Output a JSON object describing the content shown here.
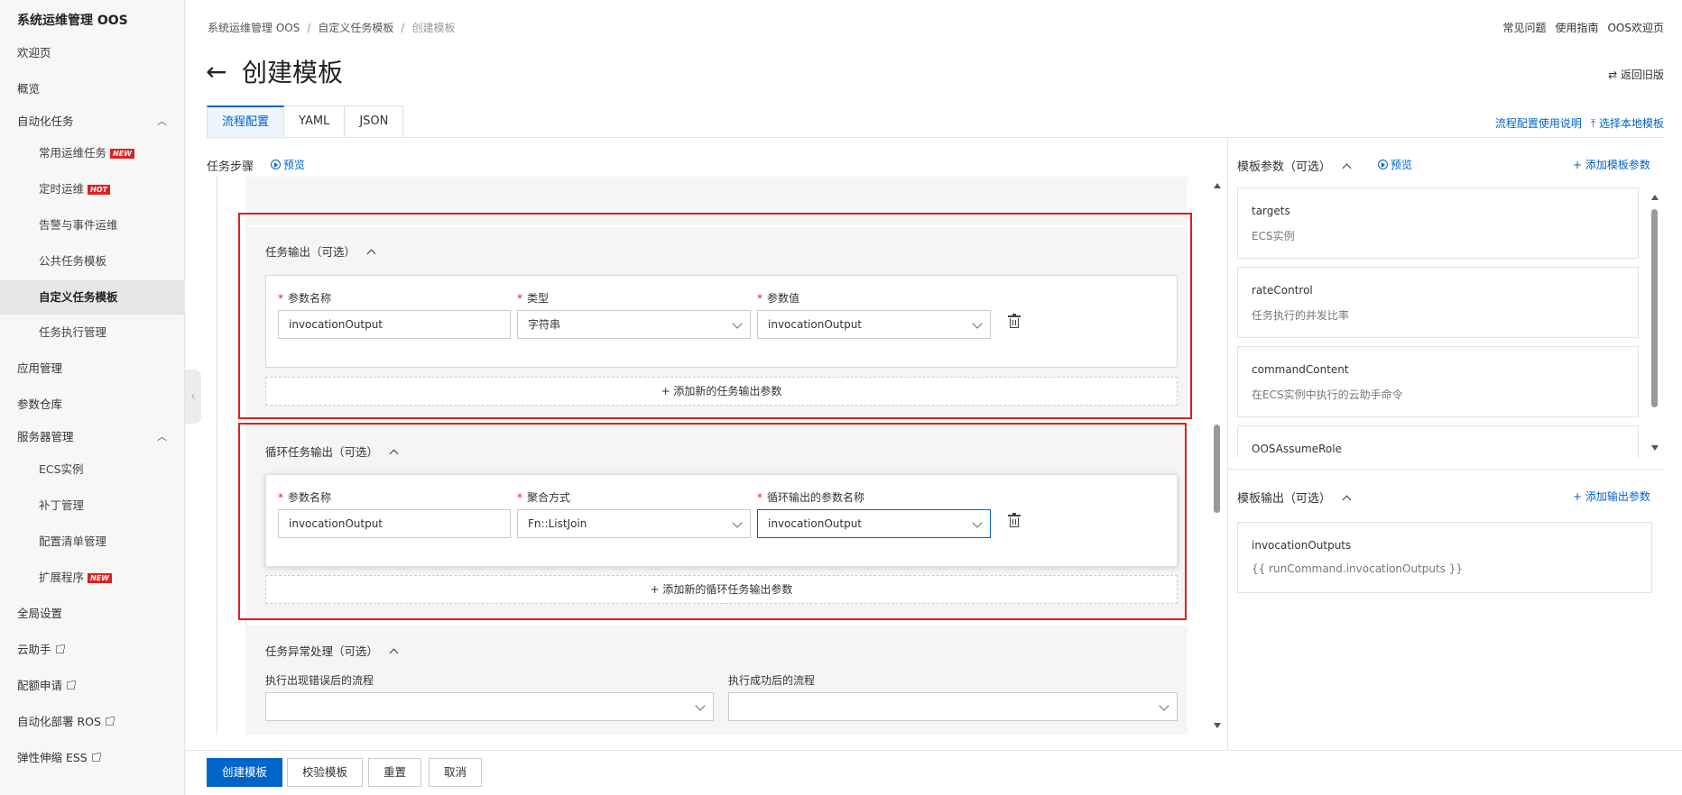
{
  "app": {
    "title": "系统运维管理 OOS"
  },
  "sidebar": {
    "items": [
      {
        "label": "欢迎页"
      },
      {
        "label": "概览"
      },
      {
        "label": "自动化任务"
      },
      {
        "label": "常用运维任务",
        "tag": "NEW"
      },
      {
        "label": "定时运维",
        "tag": "HOT"
      },
      {
        "label": "告警与事件运维"
      },
      {
        "label": "公共任务模板"
      },
      {
        "label": "自定义任务模板"
      },
      {
        "label": "任务执行管理"
      },
      {
        "label": "应用管理"
      },
      {
        "label": "参数仓库"
      },
      {
        "label": "服务器管理"
      },
      {
        "label": "ECS实例"
      },
      {
        "label": "补丁管理"
      },
      {
        "label": "配置清单管理"
      },
      {
        "label": "扩展程序",
        "tag": "NEW"
      },
      {
        "label": "全局设置"
      },
      {
        "label": "云助手"
      },
      {
        "label": "配额申请"
      },
      {
        "label": "自动化部署 ROS"
      },
      {
        "label": "弹性伸缩 ESS"
      }
    ]
  },
  "breadcrumb": [
    "系统运维管理 OOS",
    "自定义任务模板",
    "创建模板"
  ],
  "top_links": [
    "常见问题",
    "使用指南",
    "OOS欢迎页"
  ],
  "page": {
    "title": "创建模板",
    "old_version": "⇄ 返回旧版"
  },
  "tabs": [
    "流程配置",
    "YAML",
    "JSON"
  ],
  "tab_links": [
    "流程配置使用说明",
    "⤒ 选择本地模板"
  ],
  "left": {
    "steps_label": "任务步骤",
    "preview": "预览",
    "task_output": {
      "title": "任务输出（可选）",
      "labels": [
        "参数名称",
        "类型",
        "参数值"
      ],
      "values": [
        "invocationOutput",
        "字符串",
        "invocationOutput"
      ],
      "add": "+ 添加新的任务输出参数"
    },
    "loop_output": {
      "title": "循环任务输出（可选）",
      "labels": [
        "参数名称",
        "聚合方式",
        "循环输出的参数名称"
      ],
      "values": [
        "invocationOutput",
        "Fn::ListJoin",
        "invocationOutput"
      ],
      "add": "+ 添加新的循环任务输出参数"
    },
    "exception": {
      "title": "任务异常处理（可选）",
      "labels": [
        "执行出现错误后的流程",
        "执行成功后的流程"
      ]
    }
  },
  "right": {
    "params_title": "模板参数（可选）",
    "preview": "预览",
    "add_param": "+ 添加模板参数",
    "params": [
      {
        "name": "targets",
        "desc": "ECS实例"
      },
      {
        "name": "rateControl",
        "desc": "任务执行的并发比率"
      },
      {
        "name": "commandContent",
        "desc": "在ECS实例中执行的云助手命令"
      },
      {
        "name": "OOSAssumeRole",
        "desc": ""
      }
    ],
    "outputs_title": "模板输出（可选）",
    "add_output": "+ 添加输出参数",
    "outputs": [
      {
        "name": "invocationOutputs",
        "value": "{{ runCommand.invocationOutputs }}"
      }
    ]
  },
  "footer": {
    "buttons": [
      "创建模板",
      "校验模板",
      "重置",
      "取消"
    ]
  },
  "colors": {
    "accent": "#0064c8",
    "highlight": "#e02020",
    "tag": "#e02020"
  }
}
